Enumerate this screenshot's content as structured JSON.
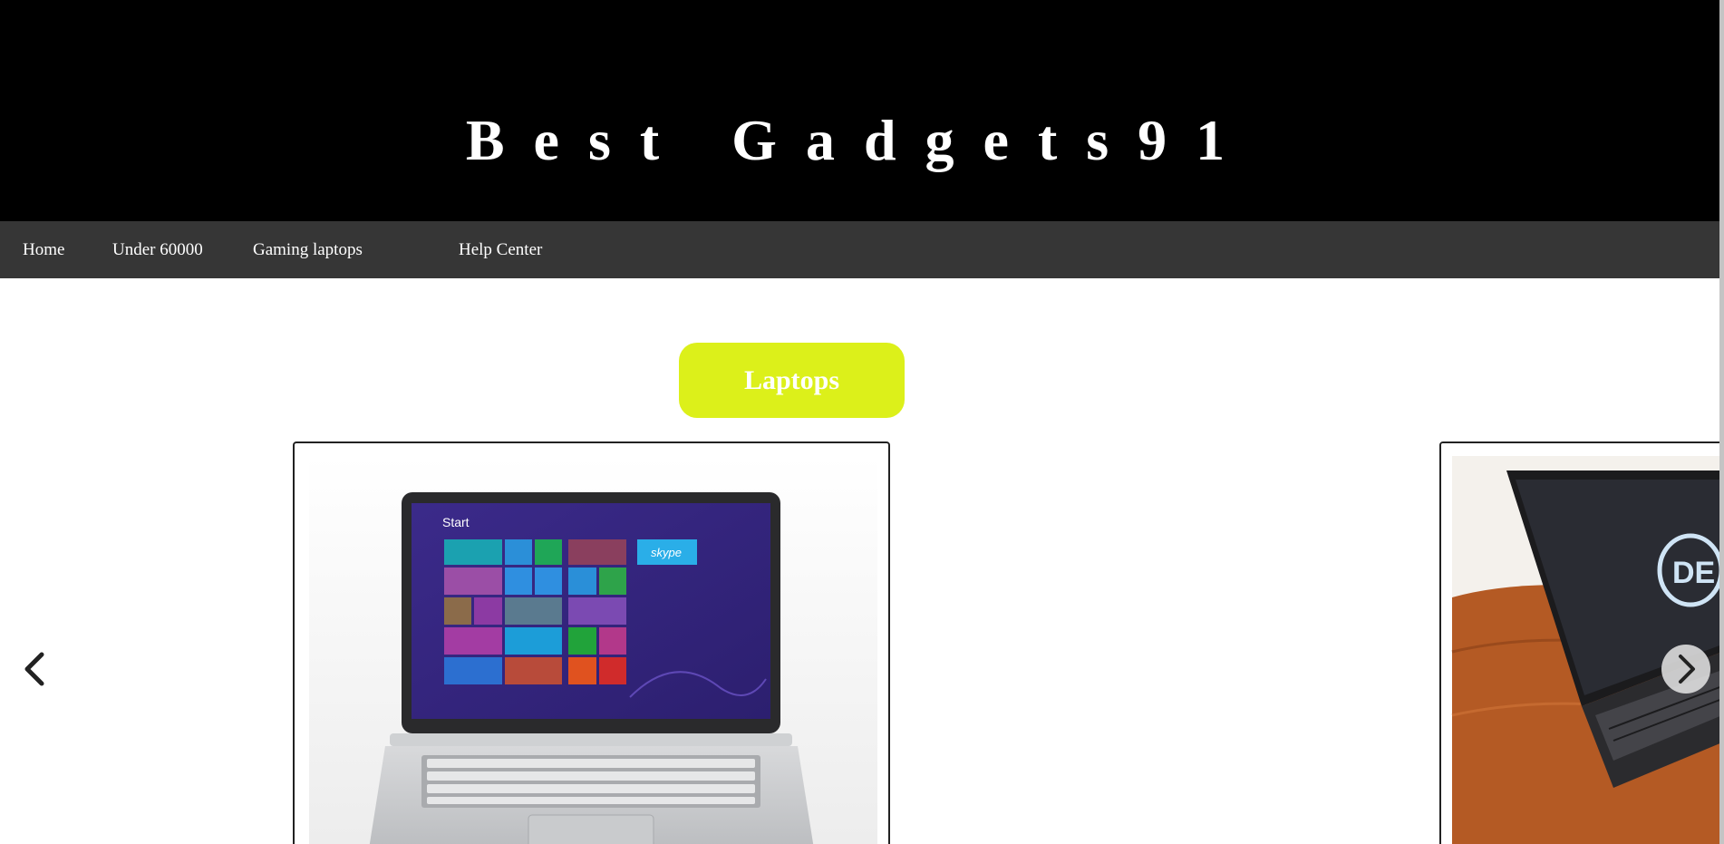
{
  "header": {
    "title": "Best Gadgets91"
  },
  "nav": {
    "items": [
      {
        "label": "Home"
      },
      {
        "label": "Under 60000"
      },
      {
        "label": "Gaming laptops"
      },
      {
        "label": "Help Center"
      }
    ]
  },
  "section": {
    "button_label": "Laptops"
  },
  "carousel": {
    "prev_icon": "chevron-left-icon",
    "next_icon": "chevron-right-icon",
    "windows_tiles": {
      "start_label": "Start",
      "skype_label": "skype"
    },
    "dell_logo_text": "DE"
  },
  "colors": {
    "header_bg": "#000000",
    "nav_bg": "#363636",
    "accent": "#dcf01a"
  }
}
